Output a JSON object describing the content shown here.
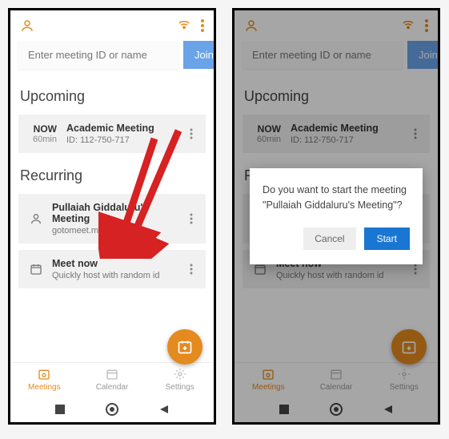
{
  "colors": {
    "accent": "#e48a1e",
    "join": "#6aa3e8",
    "dialog_primary": "#1976d2"
  },
  "header": {
    "search_placeholder": "Enter meeting ID or name",
    "join_label": "Join"
  },
  "sections": {
    "upcoming": "Upcoming",
    "recurring": "Recurring"
  },
  "upcoming": {
    "now_label": "NOW",
    "duration": "60min",
    "title": "Academic Meeting",
    "id_label": "ID: 112-750-717"
  },
  "recurring": [
    {
      "title": "Pullaiah Giddaluru's Meeting",
      "sub": "gotomeet.me/PGiddaluru",
      "icon": "person"
    },
    {
      "title": "Meet now",
      "sub": "Quickly host with random id",
      "icon": "calendar"
    }
  ],
  "tabs": {
    "meetings": "Meetings",
    "calendar": "Calendar",
    "settings": "Settings"
  },
  "dialog": {
    "line1": "Do you want to start the meeting",
    "line2": "\"Pullaiah Giddaluru's Meeting\"?",
    "cancel": "Cancel",
    "start": "Start"
  }
}
